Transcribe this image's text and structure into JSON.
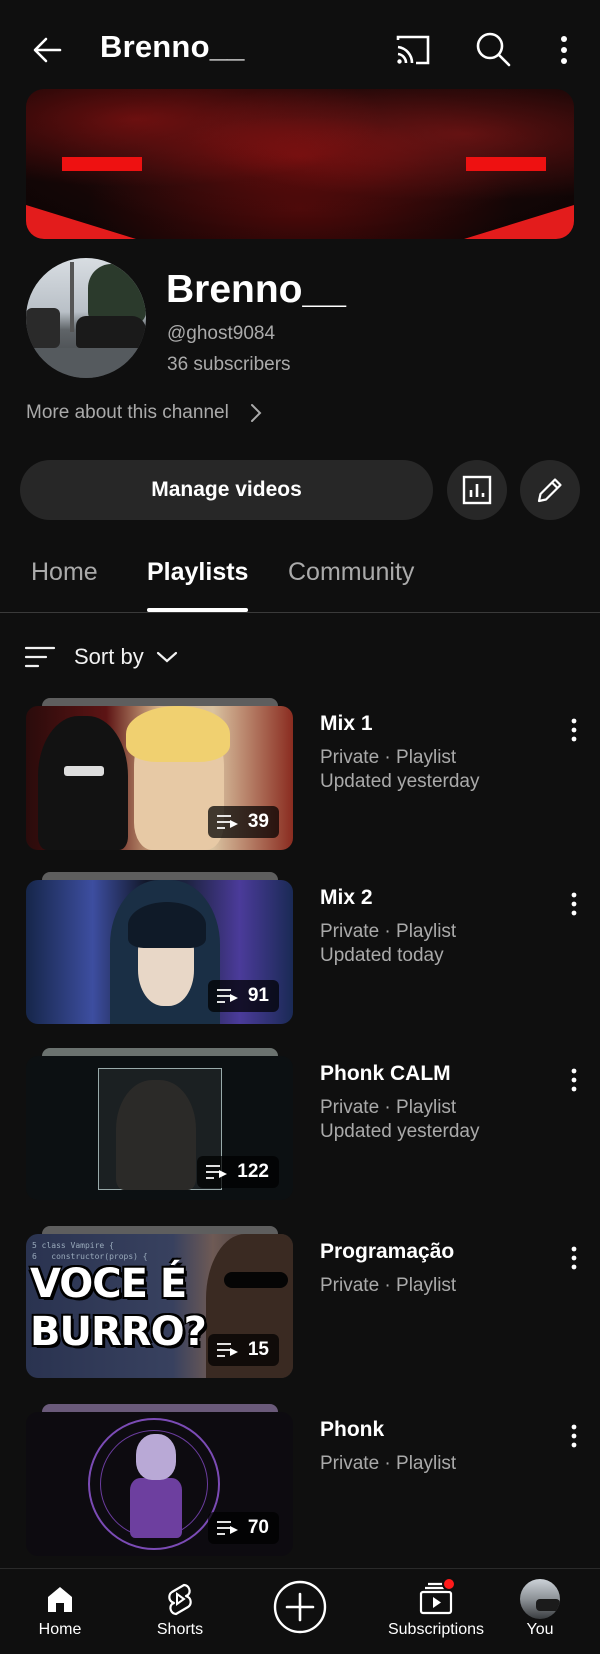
{
  "header": {
    "title": "Brenno__"
  },
  "channel": {
    "name": "Brenno__",
    "handle": "@ghost9084",
    "subscribers": "36 subscribers",
    "more_about": "More about this channel"
  },
  "actions": {
    "manage_videos": "Manage videos"
  },
  "tabs": [
    {
      "label": "Home"
    },
    {
      "label": "Playlists",
      "selected": true
    },
    {
      "label": "Community"
    }
  ],
  "sort": {
    "label": "Sort by"
  },
  "playlists": [
    {
      "name": "Mix 1",
      "privacy": "Private · Playlist",
      "updated": "Updated yesterday",
      "count": "39"
    },
    {
      "name": "Mix 2",
      "privacy": "Private · Playlist",
      "updated": "Updated today",
      "count": "91"
    },
    {
      "name": "Phonk CALM",
      "privacy": "Private · Playlist",
      "updated": "Updated yesterday",
      "count": "122"
    },
    {
      "name": "Programação",
      "privacy": "Private · Playlist",
      "updated": "",
      "count": "15",
      "thumb_text": "VOCE É BURRO?"
    },
    {
      "name": "Phonk",
      "privacy": "Private · Playlist",
      "updated": "",
      "count": "70"
    }
  ],
  "bottom_nav": {
    "home": "Home",
    "shorts": "Shorts",
    "subscriptions": "Subscriptions",
    "you": "You"
  },
  "colors": {
    "background": "#0f0f0f",
    "surface": "#272727",
    "accent": "#ff1a1a",
    "secondary_text": "#aaaaaa"
  },
  "icons": {
    "back": "arrow-left-icon",
    "cast": "cast-icon",
    "search": "search-icon",
    "more": "more-vert-icon",
    "analytics": "analytics-icon",
    "edit": "pencil-icon",
    "sort": "sort-icon",
    "playlist": "playlist-icon",
    "home": "home-icon",
    "shorts": "shorts-icon",
    "create": "plus-circle-icon",
    "subscriptions": "subscriptions-icon"
  }
}
